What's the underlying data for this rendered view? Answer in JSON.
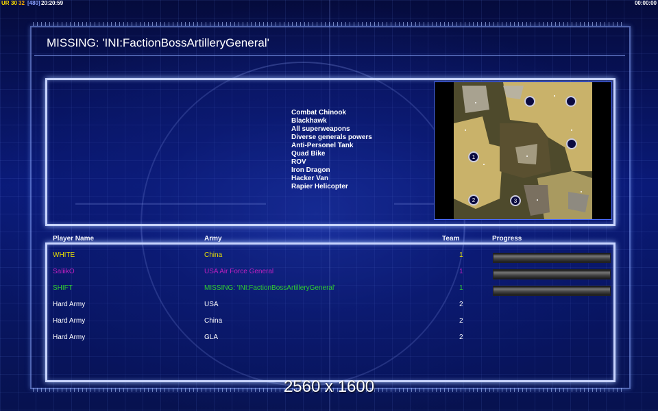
{
  "hud": {
    "ur_label": "UR",
    "fps_a": "30",
    "fps_b": "32",
    "fps_c": "[480]",
    "clock": "20:20:59",
    "timer": "00:00:00"
  },
  "title": "MISSING: 'INI:FactionBossArtilleryGeneral'",
  "rules": [
    "Combat Chinook",
    "Blackhawk",
    "All superweapons",
    "Diverse generals powers",
    "Anti-Personel Tank",
    "Quad Bike",
    "ROV",
    "Iron Dragon",
    "Hacker Van",
    "Rapier Helicopter"
  ],
  "map": {
    "start_markers": [
      "1",
      "2",
      "3"
    ]
  },
  "columns": {
    "name": "Player Name",
    "army": "Army",
    "team": "Team",
    "progress": "Progress"
  },
  "players": [
    {
      "name": "WHITE",
      "army": "China",
      "team": "1",
      "color": "#e8e000",
      "progress": 1
    },
    {
      "name": "SaliikO",
      "army": "USA Air Force General",
      "team": "1",
      "color": "#c020c0",
      "progress": 1
    },
    {
      "name": "SHIFT",
      "army": "MISSING: 'INI:FactionBossArtilleryGeneral'",
      "team": "1",
      "color": "#30d030",
      "progress": 1
    },
    {
      "name": "Hard Army",
      "army": "USA",
      "team": "2",
      "color": "#ffffff"
    },
    {
      "name": "Hard Army",
      "army": "China",
      "team": "2",
      "color": "#ffffff"
    },
    {
      "name": "Hard Army",
      "army": "GLA",
      "team": "2",
      "color": "#ffffff"
    }
  ],
  "resolution": "2560 x 1600"
}
